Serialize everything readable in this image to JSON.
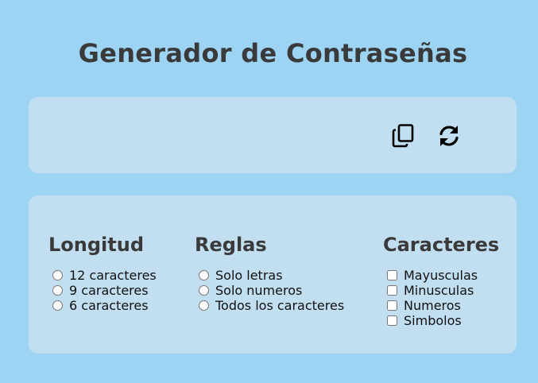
{
  "header": {
    "title": "Generador de Contraseñas"
  },
  "output": {
    "password_value": "",
    "copy_icon": "copy-icon",
    "refresh_icon": "refresh-icon"
  },
  "options": {
    "longitud": {
      "heading": "Longitud",
      "items": [
        "12 caracteres",
        "9 caracteres",
        "6 caracteres"
      ]
    },
    "reglas": {
      "heading": "Reglas",
      "items": [
        "Solo letras",
        "Solo numeros",
        "Todos los caracteres"
      ]
    },
    "caracteres": {
      "heading": "Caracteres",
      "items": [
        "Mayusculas",
        "Minusculas",
        "Numeros",
        "Simbolos"
      ]
    }
  },
  "colors": {
    "background": "#9dd4f3",
    "card": "#c2dff1",
    "heading_text": "#3a3a3a"
  }
}
